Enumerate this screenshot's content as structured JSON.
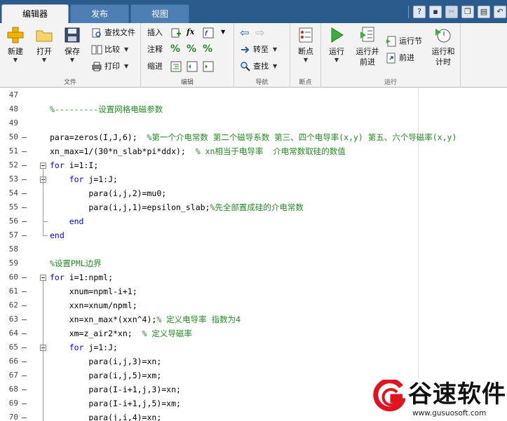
{
  "tabs": [
    {
      "label": "编辑器",
      "active": true
    },
    {
      "label": "发布",
      "active": false
    },
    {
      "label": "视图",
      "active": false
    }
  ],
  "ribbon": {
    "file": {
      "group_label": "文件",
      "new": "新建",
      "open": "打开",
      "save": "保存",
      "find_files": "查找文件",
      "compare": "比较",
      "print": "打印"
    },
    "edit": {
      "group_label": "编辑",
      "insert": "插入",
      "comment": "注释",
      "indent": "缩进",
      "fx": "fx"
    },
    "navigate": {
      "group_label": "导航",
      "goto": "转至",
      "find": "查找"
    },
    "breakpoints": {
      "group_label": "断点",
      "breakpoints": "断点"
    },
    "run": {
      "group_label": "运行",
      "run": "运行",
      "run_and_advance_1": "运行并",
      "run_and_advance_2": "前进",
      "run_section": "运行节",
      "advance": "前进",
      "run_and_time_1": "运行和",
      "run_and_time_2": "计时"
    }
  },
  "code_lines": [
    {
      "num": "47",
      "dash": false,
      "fold": "",
      "code": "",
      "style": "plain"
    },
    {
      "num": "48",
      "dash": false,
      "fold": "",
      "code": "%---------设置网格电磁参数",
      "style": "comment"
    },
    {
      "num": "49",
      "dash": false,
      "fold": "",
      "code": "",
      "style": "plain"
    },
    {
      "num": "50",
      "dash": true,
      "fold": "",
      "code": "para=zeros(I,J,6);",
      "comment": "  %第一个介电常数 第二个磁导系数 第三、四个电导率(x,y) 第五、六个导磁率(x,y)",
      "style": "mixed"
    },
    {
      "num": "51",
      "dash": true,
      "fold": "",
      "code": "xn_max=1/(30*n_slab*pi*ddx);",
      "comment": "  % xn相当于电导率  介电常数取硅的数值",
      "style": "mixed"
    },
    {
      "num": "52",
      "dash": true,
      "fold": "box",
      "kw": "for",
      "code": " i=1:I;",
      "style": "kw"
    },
    {
      "num": "53",
      "dash": true,
      "fold": "box2",
      "indent": "    ",
      "kw": "for",
      "code": " j=1:J;",
      "style": "kw"
    },
    {
      "num": "54",
      "dash": true,
      "fold": "",
      "code": "        para(i,j,2)=mu0;",
      "style": "plain"
    },
    {
      "num": "55",
      "dash": true,
      "fold": "",
      "code": "        para(i,j,1)=epsilon_slab;",
      "comment": "%先全部置成硅的介电常数",
      "style": "mixed"
    },
    {
      "num": "56",
      "dash": true,
      "fold": "end2",
      "indent": "    ",
      "kw": "end",
      "code": "",
      "style": "kw"
    },
    {
      "num": "57",
      "dash": true,
      "fold": "end1",
      "kw": "end",
      "code": "",
      "style": "kw"
    },
    {
      "num": "58",
      "dash": false,
      "fold": "",
      "code": "",
      "style": "plain"
    },
    {
      "num": "59",
      "dash": false,
      "fold": "",
      "code": "%设置PML边界",
      "style": "comment"
    },
    {
      "num": "60",
      "dash": true,
      "fold": "box",
      "kw": "for",
      "code": " i=1:npml;",
      "style": "kw"
    },
    {
      "num": "61",
      "dash": true,
      "fold": "",
      "code": "    xnum=npml-i+1;",
      "style": "plain"
    },
    {
      "num": "62",
      "dash": true,
      "fold": "",
      "code": "    xxn=xnum/npml;",
      "style": "plain"
    },
    {
      "num": "63",
      "dash": true,
      "fold": "",
      "code": "    xn=xn_max*(xxn^4);",
      "comment": "% 定义电导率 指数为4",
      "style": "mixed"
    },
    {
      "num": "64",
      "dash": true,
      "fold": "",
      "code": "    xm=z_air2*xn;",
      "comment": "  % 定义导磁率",
      "style": "mixed"
    },
    {
      "num": "65",
      "dash": true,
      "fold": "box2",
      "indent": "    ",
      "kw": "for",
      "code": " j=1:J;",
      "style": "kw"
    },
    {
      "num": "66",
      "dash": true,
      "fold": "",
      "code": "        para(i,j,3)=xn;",
      "style": "plain"
    },
    {
      "num": "67",
      "dash": true,
      "fold": "",
      "code": "        para(i,j,5)=xm;",
      "style": "plain"
    },
    {
      "num": "68",
      "dash": true,
      "fold": "",
      "code": "        para(I-i+1,j,3)=xn;",
      "style": "plain"
    },
    {
      "num": "69",
      "dash": true,
      "fold": "",
      "code": "        para(I-i+1,j,5)=xm;",
      "style": "plain"
    },
    {
      "num": "70",
      "dash": true,
      "fold": "",
      "code": "        para(j,i,4)=xn;",
      "style": "plain"
    }
  ],
  "watermark": {
    "name": "谷速软件",
    "url": "www.gusuosoft.com"
  },
  "colors": {
    "keyword": "#0000ff",
    "comment": "#228b22",
    "tabbar": "#2b5a8d",
    "ribbon": "#f3f3f3",
    "logo_red": "#e0141e"
  }
}
